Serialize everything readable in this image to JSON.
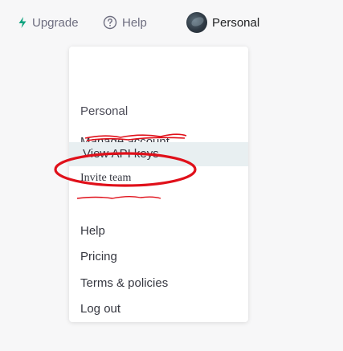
{
  "topbar": {
    "upgrade_label": "Upgrade",
    "help_label": "Help",
    "account_label": "Personal",
    "icons": {
      "upgrade": "bolt-icon",
      "help": "help-circle-icon",
      "account": "avatar"
    }
  },
  "menu": {
    "heading": "Personal",
    "items": {
      "manage_account": "Manage account",
      "view_api_keys": "View API keys",
      "invite_team": "Invite team",
      "help": "Help",
      "pricing": "Pricing",
      "terms": "Terms & policies",
      "logout": "Log out"
    }
  },
  "annotation": {
    "color": "#e0101a",
    "shape": "ellipse"
  }
}
